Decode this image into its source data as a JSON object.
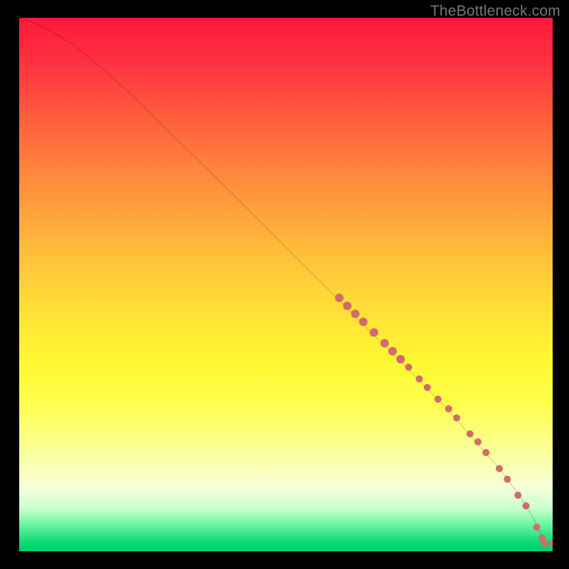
{
  "watermark": "TheBottleneck.com",
  "chart_data": {
    "type": "line",
    "title": "",
    "xlabel": "",
    "ylabel": "",
    "xlim": [
      0,
      100
    ],
    "ylim": [
      0,
      100
    ],
    "grid": false,
    "series": [
      {
        "name": "curve",
        "x": [
          0,
          3,
          6,
          10,
          15,
          20,
          25,
          30,
          35,
          40,
          45,
          50,
          55,
          60,
          65,
          70,
          75,
          80,
          83,
          86,
          90,
          93,
          95,
          97,
          98.5,
          100
        ],
        "y": [
          100,
          99,
          97.5,
          95,
          91,
          86.5,
          81.7,
          76.8,
          71.9,
          67,
          62,
          57,
          52,
          47,
          42,
          37,
          32,
          27,
          23.5,
          20,
          15.5,
          11.5,
          8.5,
          5,
          2,
          1.4
        ]
      }
    ],
    "markers": {
      "name": "dots",
      "color": "#d46b6b",
      "points": [
        {
          "x": 60.0,
          "y": 47.5,
          "r": 6
        },
        {
          "x": 61.5,
          "y": 46.0,
          "r": 6
        },
        {
          "x": 63.0,
          "y": 44.5,
          "r": 6
        },
        {
          "x": 64.5,
          "y": 43.0,
          "r": 6
        },
        {
          "x": 66.5,
          "y": 41.0,
          "r": 6
        },
        {
          "x": 68.5,
          "y": 39.0,
          "r": 6
        },
        {
          "x": 70.0,
          "y": 37.5,
          "r": 6
        },
        {
          "x": 71.5,
          "y": 36.0,
          "r": 6
        },
        {
          "x": 73.0,
          "y": 34.5,
          "r": 5
        },
        {
          "x": 75.0,
          "y": 32.3,
          "r": 5
        },
        {
          "x": 76.5,
          "y": 30.7,
          "r": 5
        },
        {
          "x": 78.5,
          "y": 28.5,
          "r": 5
        },
        {
          "x": 80.5,
          "y": 26.7,
          "r": 5
        },
        {
          "x": 82.0,
          "y": 25.0,
          "r": 5
        },
        {
          "x": 84.5,
          "y": 22.0,
          "r": 5
        },
        {
          "x": 86.0,
          "y": 20.5,
          "r": 5
        },
        {
          "x": 87.5,
          "y": 18.5,
          "r": 5
        },
        {
          "x": 90.0,
          "y": 15.5,
          "r": 5
        },
        {
          "x": 91.5,
          "y": 13.5,
          "r": 5
        },
        {
          "x": 93.5,
          "y": 10.5,
          "r": 5
        },
        {
          "x": 95.0,
          "y": 8.5,
          "r": 5
        },
        {
          "x": 97.0,
          "y": 4.5,
          "r": 5
        },
        {
          "x": 98.0,
          "y": 2.5,
          "r": 5
        },
        {
          "x": 98.5,
          "y": 1.5,
          "r": 5
        },
        {
          "x": 100.0,
          "y": 1.5,
          "r": 5
        }
      ]
    },
    "background_gradient": [
      {
        "stop": 0.0,
        "color": "#ff1a3a"
      },
      {
        "stop": 0.5,
        "color": "#ffe036"
      },
      {
        "stop": 0.85,
        "color": "#faffc0"
      },
      {
        "stop": 1.0,
        "color": "#00d470"
      }
    ]
  }
}
